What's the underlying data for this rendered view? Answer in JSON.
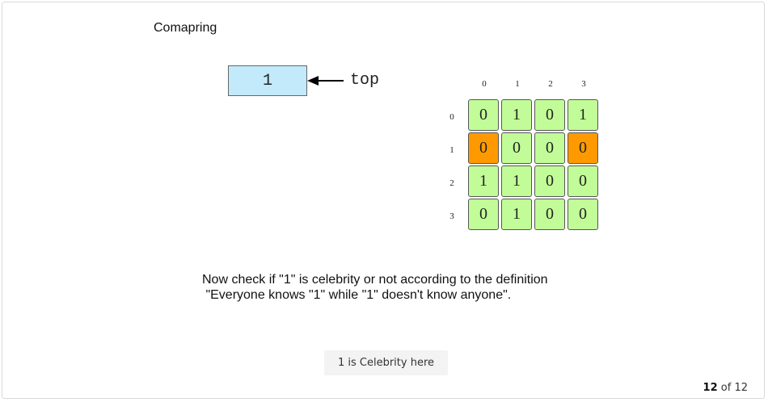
{
  "slide": {
    "heading": "Comapring",
    "stack_top_value": "1",
    "pointer_label": "top",
    "message_line1": "Now check if \"1\" is celebrity or not according to the definition",
    "message_line2": " \"Everyone knows \"1\" while \"1\" doesn't know anyone\".",
    "result_label": "1 is Celebrity here"
  },
  "matrix": {
    "col_labels": [
      "0",
      "1",
      "2",
      "3"
    ],
    "row_labels": [
      "0",
      "1",
      "2",
      "3"
    ],
    "rows": [
      [
        "0",
        "1",
        "0",
        "1"
      ],
      [
        "0",
        "0",
        "0",
        "0"
      ],
      [
        "1",
        "1",
        "0",
        "0"
      ],
      [
        "0",
        "1",
        "0",
        "0"
      ]
    ],
    "highlight_color": "#fe9a00",
    "cell_color": "#c2fc98"
  },
  "pager": {
    "current": "12",
    "separator": "of",
    "total": "12"
  }
}
